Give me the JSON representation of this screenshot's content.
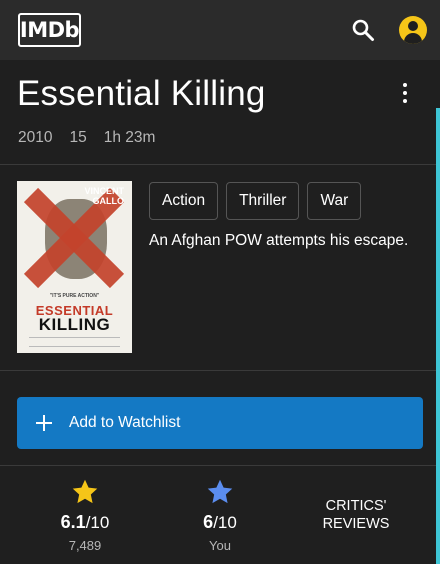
{
  "app": {
    "logo_text": "IMDb"
  },
  "colors": {
    "accent_yellow": "#f5c518",
    "watchlist_blue": "#1479c4",
    "user_star_blue": "#5b8def",
    "scroll_accent": "#3ec6d6"
  },
  "icons": {
    "search": "search-icon",
    "account": "account-icon",
    "more": "more-vertical-icon",
    "add": "plus-icon",
    "star": "star-icon"
  },
  "movie": {
    "title": "Essential Killing",
    "year": "2010",
    "certificate": "15",
    "runtime": "1h 23m",
    "genres": [
      "Action",
      "Thriller",
      "War"
    ],
    "plot": "An Afghan POW attempts his escape.",
    "poster": {
      "top_text_1": "VINCENT",
      "top_text_2": "GALLO",
      "quote": "\"IT'S PURE ACTION\"",
      "title_line_1": "ESSENTIAL",
      "title_line_2": "KILLING"
    }
  },
  "watchlist": {
    "label": "Add to Watchlist"
  },
  "ratings": {
    "imdb": {
      "score": "6.1",
      "scale": "/10",
      "votes": "7,489"
    },
    "user": {
      "score": "6",
      "scale": "/10",
      "label": "You"
    },
    "critics": {
      "line1": "CRITICS'",
      "line2": "REVIEWS"
    }
  }
}
